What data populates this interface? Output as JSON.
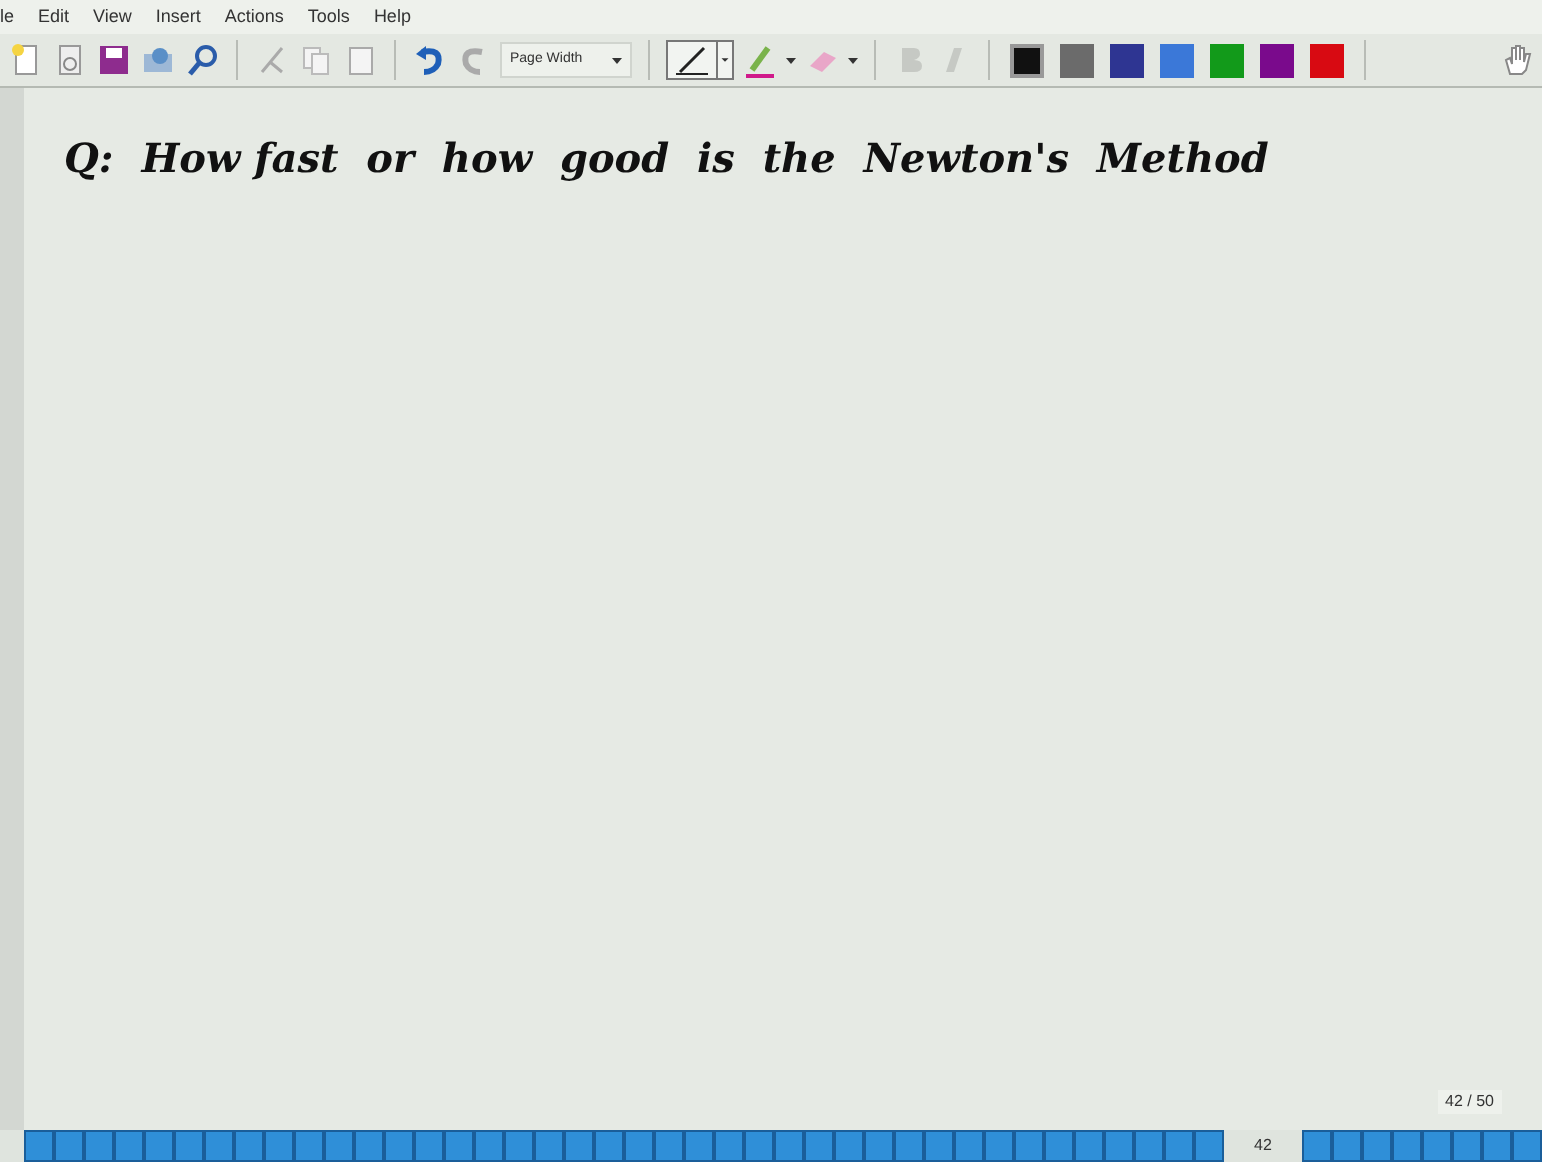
{
  "menu": [
    "le",
    "Edit",
    "View",
    "Insert",
    "Actions",
    "Tools",
    "Help"
  ],
  "toolbar": {
    "zoom": "Page Width",
    "colors": [
      {
        "color": "#111111",
        "selected": true
      },
      {
        "color": "#6b6b6b",
        "selected": false
      },
      {
        "color": "#2e3592",
        "selected": false
      },
      {
        "color": "#3b78d8",
        "selected": false
      },
      {
        "color": "#129a1a",
        "selected": false
      },
      {
        "color": "#7a0a8c",
        "selected": false
      },
      {
        "color": "#d80a12",
        "selected": false
      }
    ]
  },
  "page": {
    "note": "Q:  How fast  or  how  good  is  the  Newton's  Method",
    "page_count": "42 / 50"
  },
  "page_bar": {
    "current": "42"
  }
}
